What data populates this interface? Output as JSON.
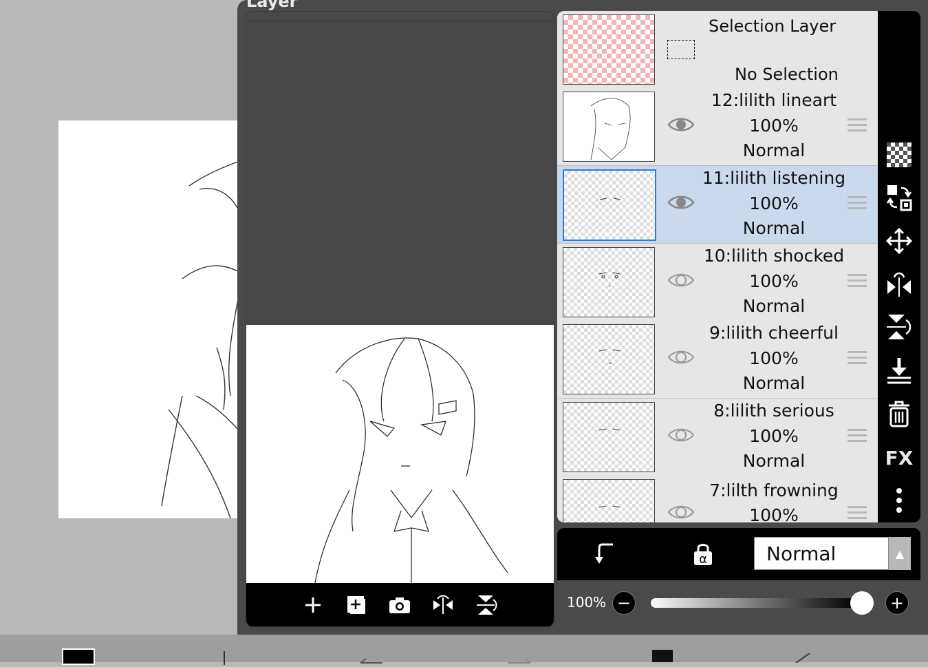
{
  "panel_title": "Layer",
  "layers": [
    {
      "name": "Selection Layer",
      "sub": "No Selection",
      "type": "selection"
    },
    {
      "name": "12:lilith lineart",
      "opacity": "100%",
      "blend": "Normal",
      "visible": true
    },
    {
      "name": "11:lilith listening",
      "opacity": "100%",
      "blend": "Normal",
      "visible": true,
      "selected": true
    },
    {
      "name": "10:lilith shocked",
      "opacity": "100%",
      "blend": "Normal",
      "visible": false
    },
    {
      "name": "9:lilith cheerful",
      "opacity": "100%",
      "blend": "Normal",
      "visible": false
    },
    {
      "name": "8:lilith serious",
      "opacity": "100%",
      "blend": "Normal",
      "visible": false
    },
    {
      "name": "7:lilth frowning",
      "opacity": "100%",
      "blend": "Normal",
      "visible": false
    }
  ],
  "side_tools": [
    "transparency-icon",
    "swap-icon",
    "move-icon",
    "flip-horizontal-icon",
    "flip-vertical-icon",
    "merge-down-icon",
    "trash-icon",
    "fx-label",
    "more-icon"
  ],
  "fx_label": "FX",
  "blend_mode": "Normal",
  "opacity_label": "100%",
  "opacity_value": 1.0,
  "preview_tools": [
    "add-layer-icon",
    "add-image-layer-icon",
    "camera-icon",
    "flip-icon",
    "flip-vertical-icon"
  ],
  "colors": {
    "panel": "#4a4a4a",
    "selected_row": "#cbd9ec",
    "accent": "#2f7ae0"
  }
}
